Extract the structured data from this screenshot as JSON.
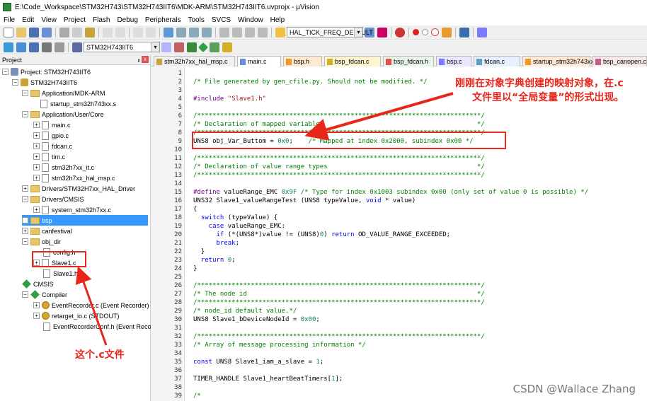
{
  "window": {
    "title": "E:\\Code_Workspace\\STM32H743\\STM32H743IIT6\\MDK-ARM\\STM32H743IIT6.uvprojx - µVision"
  },
  "menu": [
    "File",
    "Edit",
    "View",
    "Project",
    "Flash",
    "Debug",
    "Peripherals",
    "Tools",
    "SVCS",
    "Window",
    "Help"
  ],
  "toolbar": {
    "define_combo": "HAL_TICK_FREQ_DEFAULT",
    "target_combo": "STM32H743IIT6"
  },
  "project": {
    "header": "Project",
    "pin": "ᵖ",
    "close": "x",
    "exp_open": "−",
    "exp_closed": "+",
    "tree": [
      "Project: STM32H743IIT6",
      "STM32H743IIT6",
      "Application/MDK-ARM",
      "startup_stm32h743xx.s",
      "Application/User/Core",
      "main.c",
      "gpio.c",
      "fdcan.c",
      "tim.c",
      "stm32h7xx_it.c",
      "stm32h7xx_hal_msp.c",
      "Drivers/STM32H7xx_HAL_Driver",
      "Drivers/CMSIS",
      "system_stm32h7xx.c",
      "bsp",
      "canfestival",
      "obj_dir",
      "config.h",
      "Slave1.c",
      "Slave1.h",
      "CMSIS",
      "Compiler",
      "EventRecorder.c (Event Recorder)",
      "retarget_io.c (STDOUT)",
      "EventRecorderConf.h (Event Reco"
    ]
  },
  "tabs": [
    "stm32h7xx_hal_msp.c",
    "main.c",
    "bsp.h",
    "bsp_fdcan.c",
    "bsp_fdcan.h",
    "bsp.c",
    "fdcan.c",
    "startup_stm32h743xx.s",
    "bsp_canopen.c"
  ],
  "tab_colors": [
    "#f0f0f0",
    "#ffe8f0",
    "#ffe8d0",
    "#fff4d0",
    "#e8f4e8",
    "#eae8ff",
    "#e8f0ff",
    "#ffe8d8",
    "#f8e8e8"
  ],
  "editor": {
    "line_numbers": [
      "1",
      "2",
      "3",
      "4",
      "5",
      "6",
      "7",
      "8",
      "9",
      "10",
      "11",
      "12",
      "13",
      "14",
      "15",
      "16",
      "17",
      "18",
      "19",
      "20",
      "21",
      "22",
      "23",
      "24",
      "25",
      "26",
      "27",
      "28",
      "29",
      "30",
      "31",
      "32",
      "33",
      "34",
      "35",
      "36",
      "37",
      "38",
      "39"
    ],
    "lines": {
      "l2": "/* File generated by gen_cfile.py. Should not be modified. */",
      "l4_a": "#include ",
      "l4_b": "\"Slave1.h\"",
      "l6": "/**************************************************************************/",
      "l7": "/* Declaration of mapped variables                                        */",
      "l8": "/**************************************************************************/",
      "l9_a": "UNS8 obj_Var_Buttom = ",
      "l9_b": "0x0",
      "l9_c": ";",
      "l9_d": "    /* Mapped at index 0x2000, subindex 0x00 */",
      "l11": "/**************************************************************************/",
      "l12": "/* Declaration of value range types                                       */",
      "l13": "/**************************************************************************/",
      "l15_a": "#define ",
      "l15_b": "valueRange_EMC ",
      "l15_c": "0x9F",
      "l15_d": " /* Type for index 0x1003 subindex 0x00 (only set of value 0 is possible) */",
      "l16_a": "UNS32 Slave1_valueRangeTest (UNS8 typeValue, ",
      "l16_b": "void",
      "l16_c": " * value)",
      "l17": "{",
      "l18_a": "  switch",
      "l18_b": " (typeValue) {",
      "l19_a": "    case",
      "l19_b": " valueRange_EMC:",
      "l20_a": "      if",
      "l20_b": " (*(UNS8*)value != (UNS8)",
      "l20_c": "0",
      "l20_d": ") ",
      "l20_e": "return",
      "l20_f": " OD_VALUE_RANGE_EXCEEDED;",
      "l21_a": "      break",
      "l21_b": ";",
      "l22": "  }",
      "l23_a": "  return",
      "l23_b": " ",
      "l23_c": "0",
      "l23_d": ";",
      "l24": "}",
      "l26": "/**************************************************************************/",
      "l27": "/* The node id                                                            */",
      "l28": "/**************************************************************************/",
      "l29": "/* node_id default value.*/",
      "l30_a": "UNS8 Slave1_bDeviceNodeId = ",
      "l30_b": "0x00",
      "l30_c": ";",
      "l32": "/**************************************************************************/",
      "l33": "/* Array of message processing information */",
      "l35_a": "const",
      "l35_b": " UNS8 Slave1_iam_a_slave = ",
      "l35_c": "1",
      "l35_d": ";",
      "l37_a": "TIMER_HANDLE Slave1_heartBeatTimers[",
      "l37_b": "1",
      "l37_c": "];",
      "l39": "/*",
      "l40": "/*****************************************************************************"
    }
  },
  "annotations": {
    "top_line1": "刚刚在对象字典创建的映射对象，在.c",
    "top_line2": "文件里以“全局变量”的形式出现。",
    "bottom": "这个.c文件",
    "color": "#e8261a"
  },
  "watermark": "CSDN @Wallace Zhang"
}
